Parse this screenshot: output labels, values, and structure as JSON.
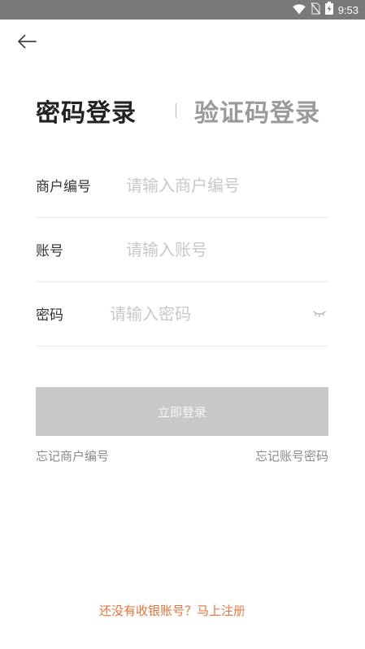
{
  "status_bar": {
    "time": "9:53",
    "icons": [
      "wifi-icon",
      "no-sim-icon",
      "battery-charging-icon"
    ]
  },
  "header": {
    "back_icon": "arrow-left-icon"
  },
  "tabs": [
    {
      "label": "密码登录",
      "active": true
    },
    {
      "label": "验证码登录",
      "active": false
    }
  ],
  "form": {
    "merchant": {
      "label": "商户编号",
      "placeholder": "请输入商户编号"
    },
    "account": {
      "label": "账号",
      "placeholder": "请输入账号"
    },
    "password": {
      "label": "密码",
      "placeholder": "请输入密码",
      "toggle_icon": "eye-closed-icon"
    }
  },
  "login_button": {
    "label": "立即登录"
  },
  "links": {
    "forgot_merchant": "忘记商户编号",
    "forgot_password": "忘记账号密码"
  },
  "register": {
    "text": "还没有收银账号？马上注册"
  },
  "colors": {
    "status_bar": "#7a7a7a",
    "button_disabled": "#c8c8c8",
    "accent": "#e8733a",
    "placeholder": "#c8c8c8"
  }
}
